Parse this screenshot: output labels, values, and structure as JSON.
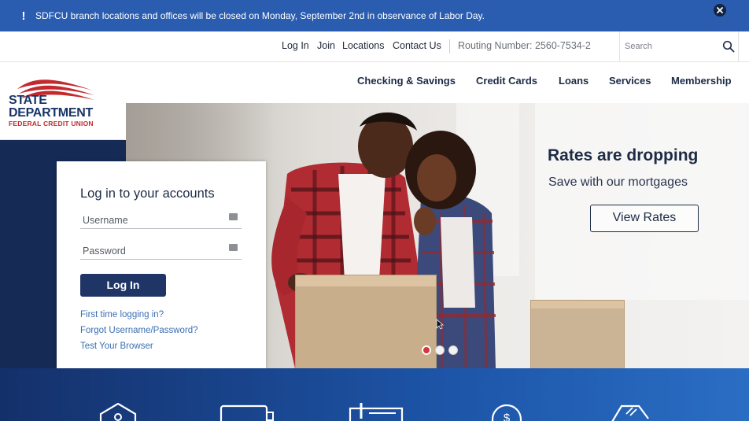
{
  "alert": {
    "icon": "exclamation-icon",
    "message": "SDFCU branch locations and offices will be closed on Monday, September 2nd in observance of Labor Day.",
    "close_icon": "close-icon"
  },
  "utility": {
    "login": "Log In",
    "join": "Join",
    "locations": "Locations",
    "contact": "Contact Us",
    "routing": "Routing Number: 2560-7534-2",
    "search_placeholder": "Search"
  },
  "logo": {
    "line1": "STATE",
    "line2": "DEPARTMENT",
    "line3": "FEDERAL CREDIT UNION"
  },
  "nav": {
    "items": [
      "Checking & Savings",
      "Credit Cards",
      "Loans",
      "Services",
      "Membership"
    ]
  },
  "login": {
    "title": "Log in to your accounts",
    "username_placeholder": "Username",
    "password_placeholder": "Password",
    "button": "Log In",
    "links": [
      "First time logging in?",
      "Forgot Username/Password?",
      "Test Your Browser"
    ]
  },
  "hero": {
    "title": "Rates are dropping",
    "subtitle": "Save with our mortgages",
    "button": "View Rates",
    "slide_count": 3,
    "active_slide": 1
  },
  "colors": {
    "brand_navy": "#1e3566",
    "alert_blue": "#2a5db0",
    "brand_red": "#c32a2e",
    "link_blue": "#3a6fb0"
  },
  "band_icons": [
    "house-icon",
    "card-icon",
    "checkbook-icon",
    "dollar-coin-icon",
    "tag-icon"
  ]
}
